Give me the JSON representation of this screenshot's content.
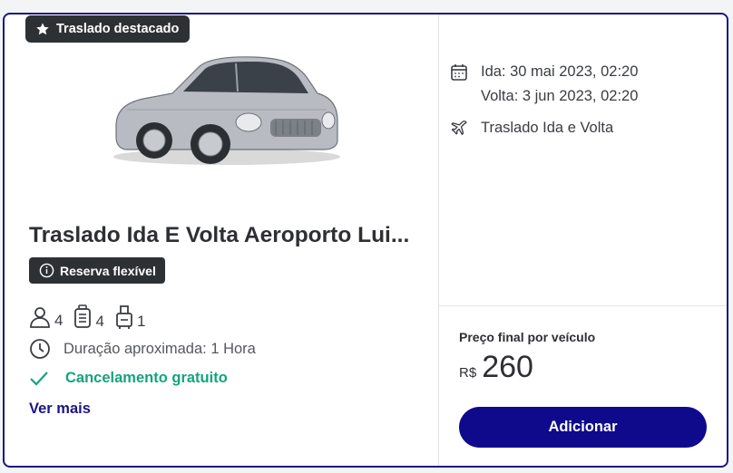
{
  "badge": {
    "label": "Traslado destacado",
    "icon": "star-icon"
  },
  "vehicle": {
    "title": "Traslado Ida E Volta Aeroporto Lui...",
    "flex_label": "Reserva flexível",
    "passengers": "4",
    "bags": "4",
    "carry_on": "1",
    "duration": "Duração aproximada: 1 Hora",
    "cancellation": "Cancelamento gratuito",
    "more_link": "Ver mais"
  },
  "trip": {
    "outbound": "Ida: 30 mai 2023, 02:20",
    "return": "Volta: 3 jun 2023, 02:20",
    "type": "Traslado Ida e Volta"
  },
  "pricing": {
    "label": "Preço final por veículo",
    "currency": "R$",
    "amount": "260",
    "button": "Adicionar"
  },
  "colors": {
    "brand": "#1c1581",
    "button": "#0f0a8c",
    "success": "#15a37d",
    "badge": "#2e3134"
  }
}
